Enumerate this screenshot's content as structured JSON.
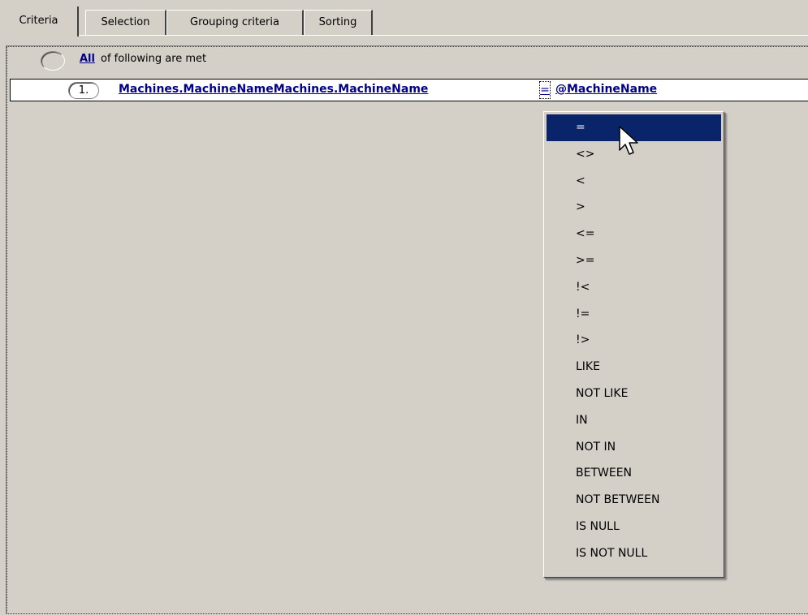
{
  "tabs": [
    {
      "label": "Criteria",
      "active": true
    },
    {
      "label": "Selection",
      "active": false
    },
    {
      "label": "Grouping criteria",
      "active": false
    },
    {
      "label": "Sorting",
      "active": false
    }
  ],
  "group": {
    "quantifier": "All",
    "suffix": "of following are met"
  },
  "condition": {
    "number": "1.",
    "field": "Machines.MachineNameMachines.MachineName",
    "operator": "=",
    "value": "@MachineName"
  },
  "operator_menu": {
    "selected": "=",
    "items": [
      "=",
      "<>",
      "<",
      ">",
      "<=",
      ">=",
      "!<",
      "!=",
      "!>",
      "LIKE",
      "NOT LIKE",
      "IN",
      "NOT IN",
      "BETWEEN",
      "NOT BETWEEN",
      "IS NULL",
      "IS NOT NULL"
    ]
  },
  "colors": {
    "background": "#d4d0c8",
    "link": "#00008b",
    "selection": "#0a246a"
  },
  "icons": {
    "cursor": "mouse-pointer-icon"
  }
}
